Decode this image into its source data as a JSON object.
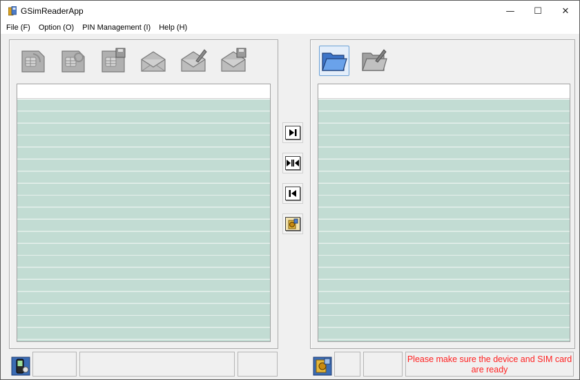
{
  "window": {
    "title": "GSimReaderApp",
    "controls": {
      "minimize": "—",
      "maximize": "☐",
      "close": "✕"
    }
  },
  "menu": {
    "items": [
      "File (F)",
      "Option (O)",
      "PIN Management (I)",
      "Help (H)"
    ]
  },
  "left_toolbar": {
    "buttons": [
      {
        "icon": "sim-card-read-icon",
        "enabled": false
      },
      {
        "icon": "sim-card-refresh-icon",
        "enabled": false
      },
      {
        "icon": "sim-card-save-icon",
        "enabled": false
      },
      {
        "icon": "envelope-icon",
        "enabled": false
      },
      {
        "icon": "envelope-edit-icon",
        "enabled": false
      },
      {
        "icon": "envelope-save-icon",
        "enabled": false
      }
    ]
  },
  "right_toolbar": {
    "buttons": [
      {
        "icon": "folder-open-icon",
        "enabled": true
      },
      {
        "icon": "folder-edit-icon",
        "enabled": false
      }
    ]
  },
  "transfer_buttons": [
    {
      "icon": "copy-right-icon"
    },
    {
      "icon": "sync-both-icon"
    },
    {
      "icon": "copy-left-icon"
    },
    {
      "icon": "clean-icon"
    }
  ],
  "status": {
    "left_icon": "phone-device-icon",
    "right_icon": "sim-connect-icon",
    "message": "Please make sure the device and SIM card are ready",
    "message_color": "#ff2020"
  },
  "colors": {
    "row_fill": "#c2dcd3",
    "row_line": "#e6f0ec",
    "active_border": "#6aa0d6"
  }
}
